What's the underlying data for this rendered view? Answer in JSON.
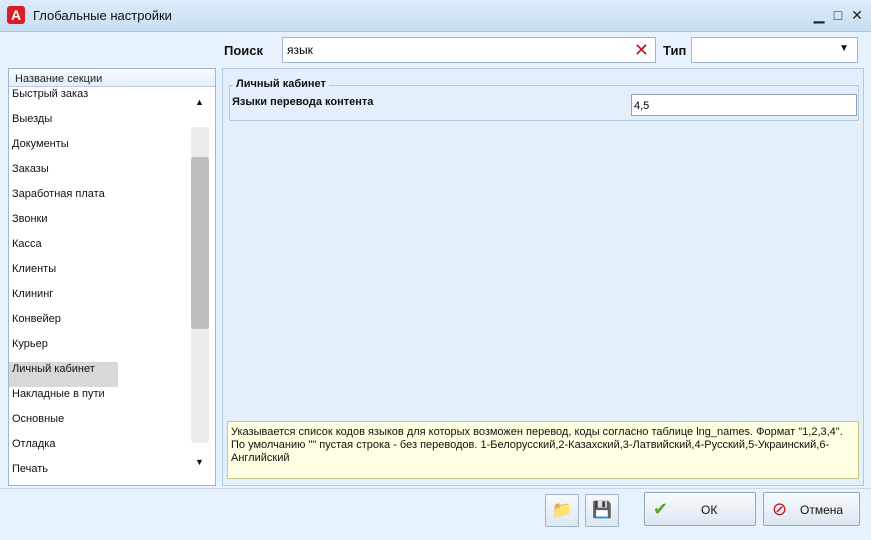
{
  "window": {
    "title": "Глобальные настройки",
    "app_icon_letter": "A",
    "minimize_glyph": "▁",
    "maximize_glyph": "□",
    "close_glyph": "✕"
  },
  "search": {
    "label": "Поиск",
    "value": "язык",
    "clear_glyph": "✕"
  },
  "type_filter": {
    "label": "Тип",
    "value": ""
  },
  "sections": {
    "header": "Название секции",
    "items": [
      "Быстрый заказ",
      "Выезды",
      "Документы",
      "Заказы",
      "Заработная плата",
      "Звонки",
      "Касса",
      "Клиенты",
      "Клининг",
      "Конвейер",
      "Курьер",
      "Личный кабинет",
      "Накладные в пути",
      "Основные",
      "Отладка",
      "Печать"
    ],
    "selected": "Личный кабинет"
  },
  "settings": {
    "group_title": "Личный кабинет",
    "property_label": "Языки перевода контента",
    "property_value": "4,5",
    "help_text": "Указывается список кодов языков для которых возможен перевод, коды согласно таблице lng_names. Формат \"1,2,3,4\". По умолчанию \"\" пустая строка - без переводов. 1-Белорусский,2-Казахский,3-Латвийский,4-Русский,5-Украинский,6-Английский"
  },
  "footer": {
    "ok_label": "ОК",
    "cancel_label": "Отмена"
  },
  "icons": {
    "folder": "folder-icon",
    "save": "save-icon",
    "ok": "checkmark-icon",
    "cancel": "cancel-icon"
  },
  "colors": {
    "accent_red": "#c4161c",
    "help_background": "#ffffe1",
    "ok_green": "#5aa72b"
  }
}
